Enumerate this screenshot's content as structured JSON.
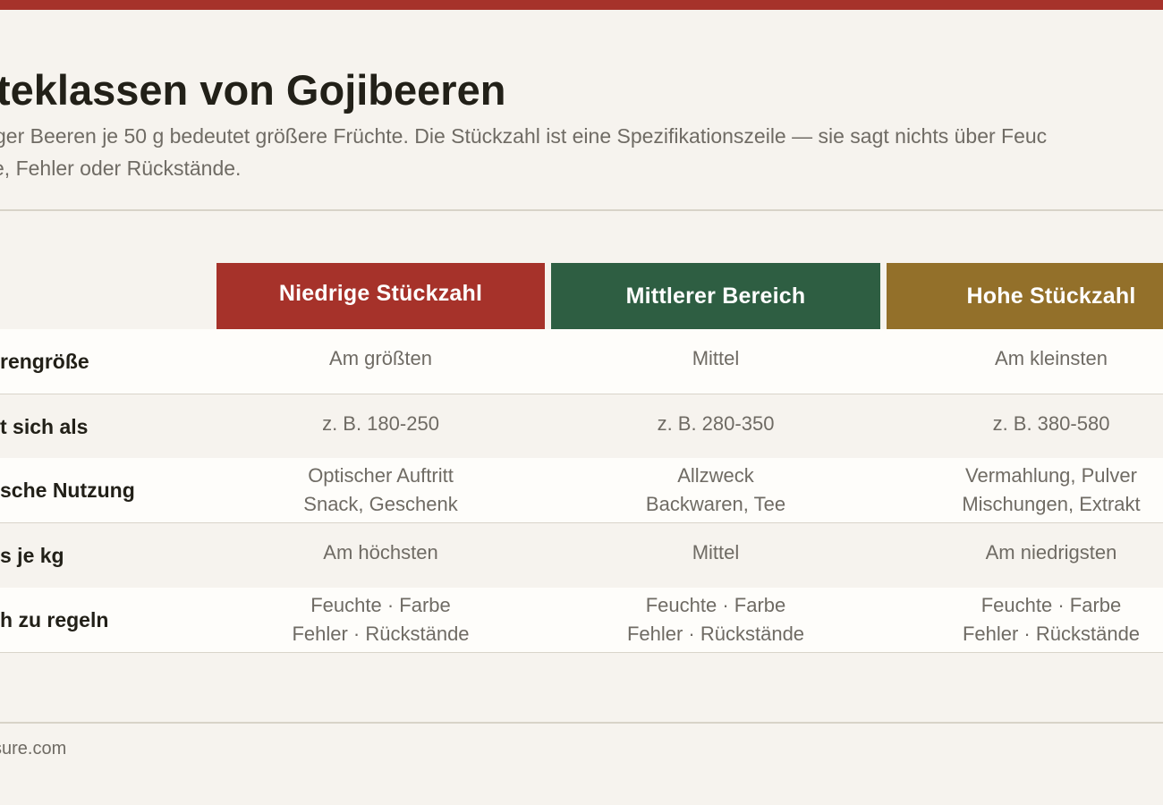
{
  "header": {
    "title": "teklassen von Gojibeeren",
    "subtitle_line1": "ger Beeren je 50 g bedeutet größere Früchte. Die Stückzahl ist eine Spezifikationszeile — sie sagt nichts über Feuc",
    "subtitle_line2": "e, Fehler oder Rückstände."
  },
  "colors": {
    "accent_red": "#a6322a",
    "accent_green": "#2e5e42",
    "accent_gold": "#93702a"
  },
  "table": {
    "columns": [
      {
        "label": "Niedrige Stückzahl",
        "color": "#a6322a"
      },
      {
        "label": "Mittlerer Bereich",
        "color": "#2e5e42"
      },
      {
        "label": "Hohe Stückzahl",
        "color": "#93702a"
      }
    ],
    "rows": [
      {
        "label": "rengröße",
        "cells": [
          {
            "line1": "Am größten",
            "line2": ""
          },
          {
            "line1": "Mittel",
            "line2": ""
          },
          {
            "line1": "Am kleinsten",
            "line2": ""
          }
        ]
      },
      {
        "label": "t sich als",
        "cells": [
          {
            "line1": "z. B. 180-250",
            "line2": ""
          },
          {
            "line1": "z. B. 280-350",
            "line2": ""
          },
          {
            "line1": "z. B. 380-580",
            "line2": ""
          }
        ]
      },
      {
        "label": "sche Nutzung",
        "cells": [
          {
            "line1": "Optischer Auftritt",
            "line2": "Snack, Geschenk"
          },
          {
            "line1": "Allzweck",
            "line2": "Backwaren, Tee"
          },
          {
            "line1": "Vermahlung, Pulver",
            "line2": "Mischungen, Extrakt"
          }
        ]
      },
      {
        "label": "s je kg",
        "cells": [
          {
            "line1": "Am höchsten",
            "line2": ""
          },
          {
            "line1": "Mittel",
            "line2": ""
          },
          {
            "line1": "Am niedrigsten",
            "line2": ""
          }
        ]
      },
      {
        "label": "h zu regeln",
        "cells": [
          {
            "line1": "Feuchte · Farbe",
            "line2": "Fehler · Rückstände"
          },
          {
            "line1": "Feuchte · Farbe",
            "line2": "Fehler · Rückstände"
          },
          {
            "line1": "Feuchte · Farbe",
            "line2": "Fehler · Rückstände"
          }
        ]
      }
    ]
  },
  "footer": {
    "text": "sure.com"
  }
}
